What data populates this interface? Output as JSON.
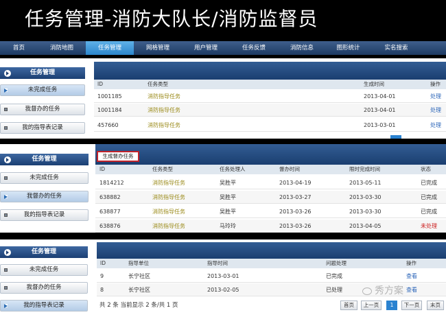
{
  "title": {
    "main": "任务管理",
    "sub": "-消防大队长/消防监督员"
  },
  "nav": {
    "items": [
      "首页",
      "消防地图",
      "任务管理",
      "网格管理",
      "用户管理",
      "任务反馈",
      "消防信息",
      "图形统计",
      "实名搜索"
    ],
    "active_index": 2
  },
  "sidebar": {
    "header": "任务管理",
    "items": [
      "未完成任务",
      "我督办的任务",
      "我的指导表记录"
    ]
  },
  "panel1": {
    "columns": [
      "ID",
      "任务类型",
      "生成时间",
      "操作"
    ],
    "rows": [
      {
        "id": "1001185",
        "type": "消防指导任务",
        "time": "2013-04-01",
        "op": "处理"
      },
      {
        "id": "1001184",
        "type": "消防指导任务",
        "time": "2013-04-01",
        "op": "处理"
      },
      {
        "id": "457660",
        "type": "消防指导任务",
        "time": "2013-03-01",
        "op": "处理"
      }
    ]
  },
  "panel2": {
    "button": "生成督办任务",
    "columns": [
      "ID",
      "任务类型",
      "任务处理人",
      "督办时间",
      "限时完成时间",
      "状态"
    ],
    "rows": [
      {
        "id": "1814212",
        "type": "消防指导任务",
        "handler": "吴胜平",
        "time": "2013-04-19",
        "deadline": "2013-05-11",
        "status": "已完成"
      },
      {
        "id": "638882",
        "type": "消防指导任务",
        "handler": "吴胜平",
        "time": "2013-03-27",
        "deadline": "2013-03-30",
        "status": "已完成"
      },
      {
        "id": "638877",
        "type": "消防指导任务",
        "handler": "吴胜平",
        "time": "2013-03-26",
        "deadline": "2013-03-30",
        "status": "已完成"
      },
      {
        "id": "638876",
        "type": "消防指导任务",
        "handler": "马玲玲",
        "time": "2013-03-26",
        "deadline": "2013-04-05",
        "status": "未处理"
      }
    ]
  },
  "panel3": {
    "columns": [
      "ID",
      "指导单位",
      "指导时间",
      "问题处理",
      "操作"
    ],
    "rows": [
      {
        "id": "9",
        "unit": "长宁社区",
        "time": "2013-03-01",
        "issue": "已完成",
        "op": "查看"
      },
      {
        "id": "8",
        "unit": "长宁社区",
        "time": "2013-02-05",
        "issue": "已处理",
        "op": "查看"
      }
    ],
    "pagination": {
      "summary": "共 2 条 当前显示 2 条/共 1 页",
      "first": "首页",
      "prev": "上一页",
      "current": "1",
      "next": "下一页",
      "last": "末页"
    }
  },
  "watermark": "秀方案",
  "colors": {
    "nav_active": "#2c86cc",
    "header_blue": "#1a3e70",
    "task_type": "#9a8a18",
    "link": "#2a64b8",
    "unprocessed": "#cc1d1d"
  }
}
